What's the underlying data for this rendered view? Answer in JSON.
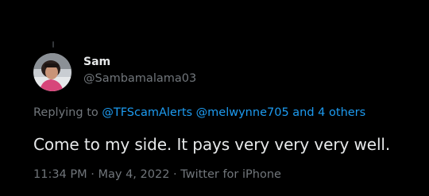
{
  "tweet": {
    "author": {
      "display_name": "Sam",
      "handle": "@Sambamalama03"
    },
    "replying_to": {
      "prefix": "Replying to",
      "mentions": [
        "@TFScamAlerts",
        "@melwynne705"
      ],
      "and_text": "and",
      "others": "4 others"
    },
    "text": "Come to my side. It pays very very very well.",
    "meta": {
      "time": "11:34 PM",
      "separator": "·",
      "date": "May 4, 2022",
      "source": "Twitter for iPhone"
    }
  },
  "colors": {
    "background": "#000000",
    "primary_text": "#e7e9ea",
    "secondary_text": "#71767b",
    "link": "#1d9bf0"
  }
}
